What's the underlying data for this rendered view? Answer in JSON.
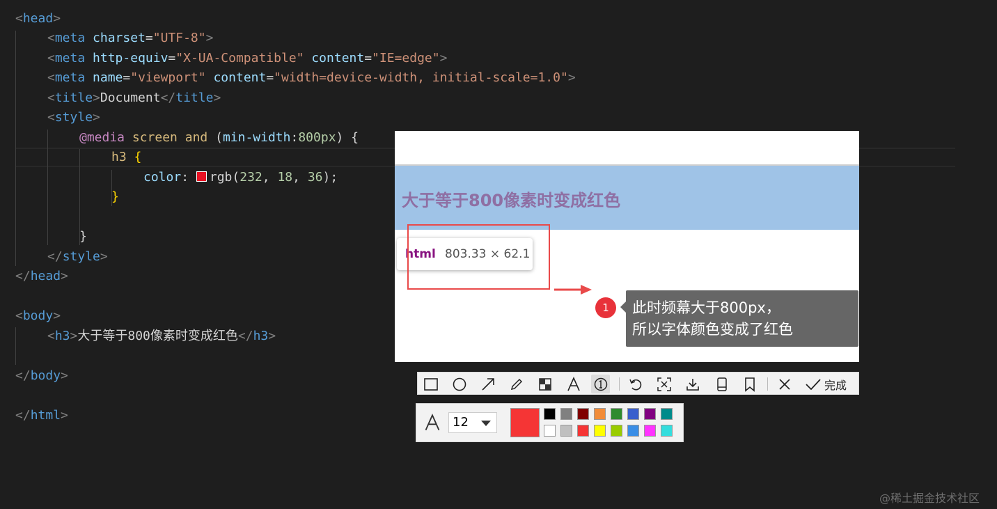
{
  "code": {
    "head_open": "<head>",
    "meta_charset": {
      "tag": "meta",
      "attr": "charset",
      "value": "\"UTF-8\""
    },
    "meta_compat": {
      "tag": "meta",
      "attr1": "http-equiv",
      "value1": "\"X-UA-Compatible\"",
      "attr2": "content",
      "value2": "\"IE=edge\""
    },
    "meta_viewport": {
      "tag": "meta",
      "attr1": "name",
      "value1": "\"viewport\"",
      "attr2": "content",
      "value2": "\"width=device-width, initial-scale=1.0\""
    },
    "title": {
      "tag": "title",
      "text": "Document"
    },
    "style_tag": "style",
    "media": {
      "at": "@media",
      "type": "screen",
      "and": "and",
      "feature": "min-width",
      "value": "800px"
    },
    "selector": "h3",
    "decl": {
      "prop": "color",
      "func": "rgb",
      "args_num": [
        "232",
        "18",
        "36"
      ]
    },
    "head_close": "head",
    "body_tag": "body",
    "h3_line": {
      "tag": "h3",
      "text": "大于等于800像素时变成红色"
    },
    "html_close": "html"
  },
  "preview": {
    "heading": "大于等于800像素时变成红色",
    "tooltip": {
      "element": "html",
      "size": "803.33 × 62.1"
    },
    "annotation": {
      "marker": "1",
      "line1": "此时频幕大于800px，",
      "line2": "所以字体颜色变成了红色"
    }
  },
  "toolbar": {
    "tools": [
      "rectangle-icon",
      "ellipse-icon",
      "arrow-icon",
      "pen-icon",
      "mosaic-icon",
      "text-icon",
      "number-marker-icon",
      "undo-icon",
      "ocr-icon",
      "download-icon",
      "pin-icon",
      "bookmark-icon",
      "close-icon"
    ],
    "done_label": "完成"
  },
  "subbar": {
    "font_size": "12",
    "current_color": "#f53535",
    "palette": [
      "#000000",
      "#808080",
      "#800000",
      "#f28c38",
      "#2e8b2e",
      "#3a5fcd",
      "#800080",
      "#008b8b",
      "#ffffff",
      "#c0c0c0",
      "#f53535",
      "#ffff00",
      "#99cc00",
      "#3a8ee6",
      "#ff33ff",
      "#33dddd"
    ]
  },
  "watermark": "@稀土掘金技术社区"
}
